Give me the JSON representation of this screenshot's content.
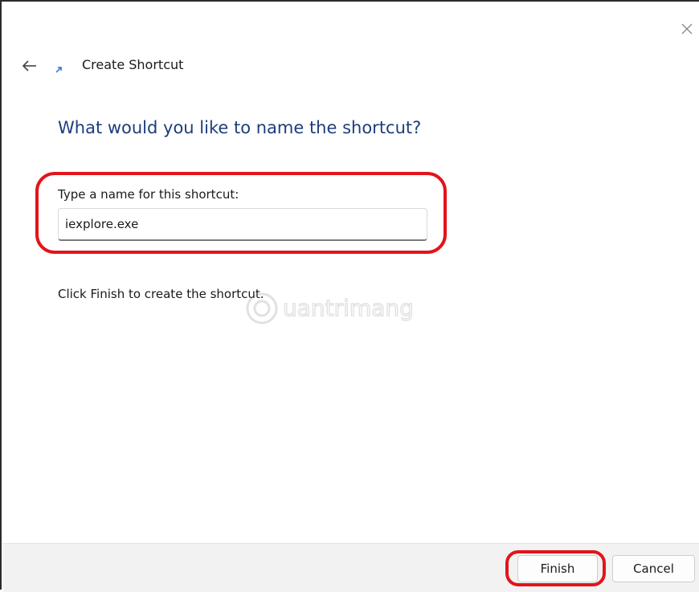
{
  "window": {
    "title": "Create Shortcut",
    "icons": {
      "back": "back-arrow-icon",
      "title": "shortcut-icon",
      "close": "close-icon"
    }
  },
  "main": {
    "heading": "What would you like to name the shortcut?",
    "name_label": "Type a name for this shortcut:",
    "name_value": "iexplore.exe",
    "instruction": "Click Finish to create the shortcut."
  },
  "footer": {
    "finish_label": "Finish",
    "cancel_label": "Cancel"
  },
  "colors": {
    "heading": "#1e3d7b",
    "annotation_highlight": "#e3141b",
    "footer_bg": "#f2f2f2"
  }
}
